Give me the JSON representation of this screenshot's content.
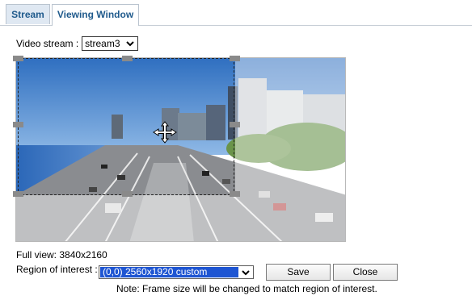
{
  "tabs": [
    {
      "label": "Stream",
      "active": false
    },
    {
      "label": "Viewing Window",
      "active": true
    }
  ],
  "stream": {
    "label": "Video stream :",
    "value": "stream3"
  },
  "full_view": "Full view: 3840x2160",
  "roi": {
    "label": "Region of interest :",
    "value": "(0,0) 2560x1920 custom"
  },
  "buttons": {
    "save": "Save",
    "close": "Close"
  },
  "note": "Note: Frame size will be changed to match region of interest.",
  "colors": {
    "tab_text": "#1f5a8c",
    "selected_option": "#1e55d2"
  }
}
